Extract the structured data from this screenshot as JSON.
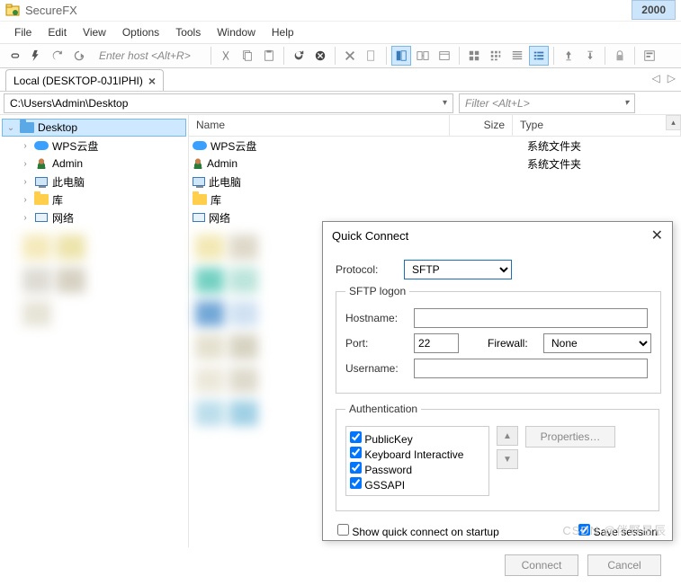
{
  "app": {
    "title": "SecureFX"
  },
  "menu": [
    "File",
    "Edit",
    "View",
    "Options",
    "Tools",
    "Window",
    "Help"
  ],
  "toolbar": {
    "enter_host": "Enter host <Alt+R>"
  },
  "tab": {
    "label": "Local (DESKTOP-0J1IPHI)",
    "year": "2000"
  },
  "path": {
    "value": "C:\\Users\\Admin\\Desktop",
    "filter_placeholder": "Filter <Alt+L>"
  },
  "tree": {
    "root": "Desktop",
    "items": [
      "WPS云盘",
      "Admin",
      "此电脑",
      "库",
      "网络"
    ]
  },
  "list": {
    "columns": {
      "name": "Name",
      "size": "Size",
      "type": "Type"
    },
    "rows": [
      {
        "name": "WPS云盘",
        "type": "系统文件夹",
        "icon": "cloud"
      },
      {
        "name": "Admin",
        "type": "系统文件夹",
        "icon": "user"
      },
      {
        "name": "此电脑",
        "type": "",
        "icon": "pc"
      },
      {
        "name": "库",
        "type": "",
        "icon": "folder"
      },
      {
        "name": "网络",
        "type": "",
        "icon": "net"
      }
    ]
  },
  "dialog": {
    "title": "Quick Connect",
    "protocol_label": "Protocol:",
    "protocol_value": "SFTP",
    "logon_legend": "SFTP logon",
    "hostname_label": "Hostname:",
    "hostname_value": "",
    "port_label": "Port:",
    "port_value": "22",
    "firewall_label": "Firewall:",
    "firewall_value": "None",
    "username_label": "Username:",
    "username_value": "",
    "auth_legend": "Authentication",
    "auth_items": [
      "PublicKey",
      "Keyboard Interactive",
      "Password",
      "GSSAPI"
    ],
    "properties_btn": "Properties…",
    "show_startup": "Show quick connect on startup",
    "save_session": "Save session",
    "connect_btn": "Connect",
    "cancel_btn": "Cancel"
  },
  "watermark": "CSDN @伴野星辰"
}
